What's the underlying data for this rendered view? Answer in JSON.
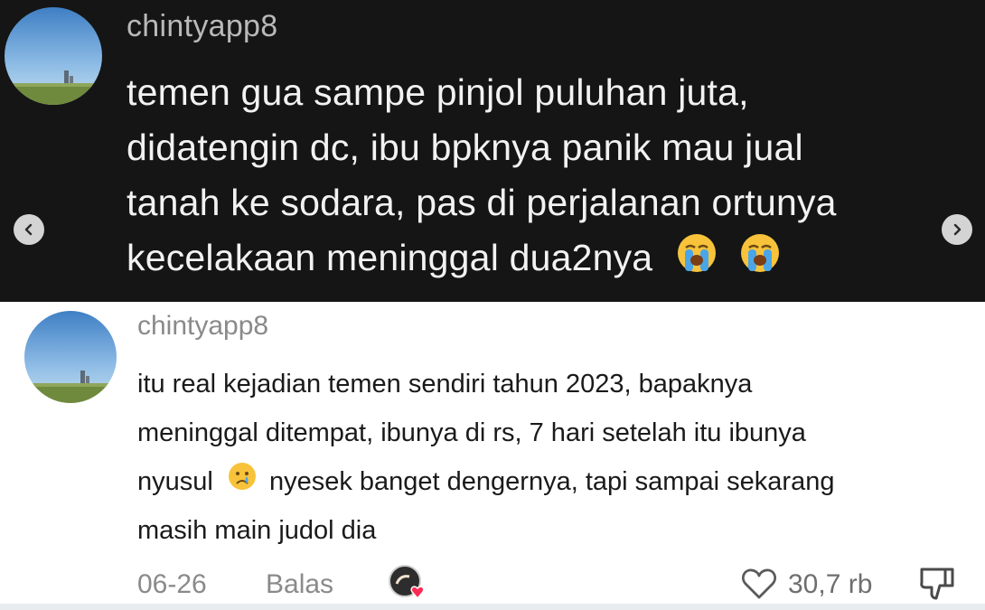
{
  "top_comment": {
    "username": "chintyapp8",
    "lines": [
      "temen gua sampe pinjol puluhan juta,",
      "didatengin dc, ibu bpknya panik mau jual",
      "tanah ke sodara, pas di perjalanan ortunya",
      "kecelakaan meninggal dua2nya"
    ],
    "trailing_emojis": [
      "loudly-crying-face-emoji",
      "loudly-crying-face-emoji"
    ]
  },
  "carousel": {
    "prev_icon": "chevron-left-icon",
    "next_icon": "chevron-right-icon"
  },
  "reply_comment": {
    "username": "chintyapp8",
    "line1": "itu real kejadian temen sendiri tahun 2023, bapaknya",
    "line2": "meninggal ditempat, ibunya di rs, 7 hari setelah itu ibunya",
    "line3_before_emoji": "nyusul",
    "line3_emoji": "crying-face-emoji",
    "line3_after_emoji": "nyesek banget dengernya, tapi sampai sekarang",
    "line4": "masih main judol dia",
    "footer": {
      "date": "06-26",
      "reply_label": "Balas",
      "like_count": "30,7 rb",
      "like_icon": "heart-outline-icon",
      "dislike_icon": "thumbs-down-icon",
      "creator_liked_icon": "creator-avatar-heart-icon"
    }
  },
  "colors": {
    "dark_bg": "#151515",
    "dark_text": "#f2f2f2",
    "muted_text": "#8a8a8a",
    "heart_badge": "#fe2c55"
  }
}
